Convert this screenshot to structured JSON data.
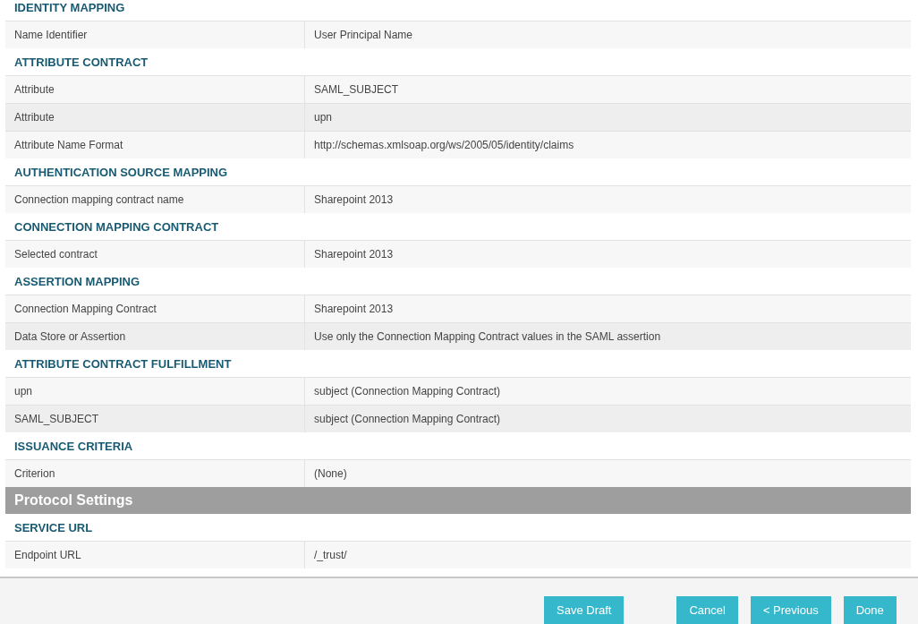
{
  "sections": [
    {
      "kind": "section",
      "title": "IDENTITY MAPPING",
      "rows": [
        {
          "label": "Name Identifier",
          "value": "User Principal Name"
        }
      ]
    },
    {
      "kind": "section",
      "title": "ATTRIBUTE CONTRACT",
      "rows": [
        {
          "label": "Attribute",
          "value": "SAML_SUBJECT"
        },
        {
          "label": "Attribute",
          "value": "upn"
        },
        {
          "label": "Attribute Name Format",
          "value": "http://schemas.xmlsoap.org/ws/2005/05/identity/claims"
        }
      ]
    },
    {
      "kind": "section",
      "title": "AUTHENTICATION SOURCE MAPPING",
      "rows": [
        {
          "label": "Connection mapping contract name",
          "value": "Sharepoint 2013"
        }
      ]
    },
    {
      "kind": "section",
      "title": "CONNECTION MAPPING CONTRACT",
      "rows": [
        {
          "label": "Selected contract",
          "value": "Sharepoint 2013"
        }
      ]
    },
    {
      "kind": "section",
      "title": "ASSERTION MAPPING",
      "rows": [
        {
          "label": "Connection Mapping Contract",
          "value": "Sharepoint 2013"
        },
        {
          "label": "Data Store or Assertion",
          "value": "Use only the Connection Mapping Contract values in the SAML assertion"
        }
      ]
    },
    {
      "kind": "section",
      "title": "ATTRIBUTE CONTRACT FULFILLMENT",
      "rows": [
        {
          "label": "upn",
          "value": "subject (Connection Mapping Contract)"
        },
        {
          "label": "SAML_SUBJECT",
          "value": "subject (Connection Mapping Contract)"
        }
      ]
    },
    {
      "kind": "section",
      "title": "ISSUANCE CRITERIA",
      "rows": [
        {
          "label": "Criterion",
          "value": "(None)"
        }
      ]
    },
    {
      "kind": "group",
      "title": "Protocol Settings"
    },
    {
      "kind": "section",
      "title": "SERVICE URL",
      "rows": [
        {
          "label": "Endpoint URL",
          "value": "/_trust/"
        }
      ]
    }
  ],
  "buttons": [
    {
      "label": "Save Draft",
      "kind": "draft"
    },
    {
      "label": "Cancel",
      "kind": "nav"
    },
    {
      "label": "< Previous",
      "kind": "nav"
    },
    {
      "label": "Done",
      "kind": "nav"
    }
  ]
}
